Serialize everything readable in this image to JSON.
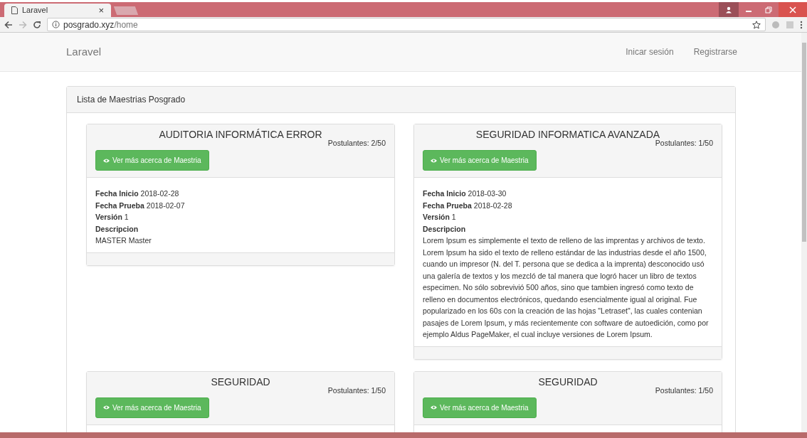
{
  "browser": {
    "tab": {
      "title": "Laravel",
      "close": "×",
      "selected": true
    },
    "address": {
      "host": "posgrado.xyz",
      "path": "/home"
    }
  },
  "navbar": {
    "brand": "Laravel",
    "links": [
      "Inicar sesión",
      "Registrarse"
    ]
  },
  "panel": {
    "title": "Lista de Maestrias Posgrado",
    "cards": [
      {
        "title": "AUDITORIA INFORMÁTICA ERROR",
        "applicants": "Postulantes: 2/50",
        "button": "Ver más acerca de Maestria",
        "fields": [
          {
            "label": "Fecha Inicio",
            "value": "2018-02-28"
          },
          {
            "label": "Fecha Prueba",
            "value": "2018-02-07"
          },
          {
            "label": "Versión",
            "value": "1"
          }
        ],
        "description_label": "Descripcion",
        "description": "MASTER Master"
      },
      {
        "title": "SEGURIDAD INFORMATICA AVANZADA",
        "applicants": "Postulantes: 1/50",
        "button": "Ver más acerca de Maestria",
        "fields": [
          {
            "label": "Fecha Inicio",
            "value": "2018-03-30"
          },
          {
            "label": "Fecha Prueba",
            "value": "2018-02-28"
          },
          {
            "label": "Versión",
            "value": "1"
          }
        ],
        "description_label": "Descripcion",
        "description": "Lorem Ipsum es simplemente el texto de relleno de las imprentas y archivos de texto. Lorem Ipsum ha sido el texto de relleno estándar de las industrias desde el año 1500, cuando un impresor (N. del T. persona que se dedica a la imprenta) desconocido usó una galería de textos y los mezcló de tal manera que logró hacer un libro de textos especimen. No sólo sobrevivió 500 años, sino que tambien ingresó como texto de relleno en documentos electrónicos, quedando esencialmente igual al original. Fue popularizado en los 60s con la creación de las hojas \"Letraset\", las cuales contenian pasajes de Lorem Ipsum, y más recientemente con software de autoedición, como por ejemplo Aldus PageMaker, el cual incluye versiones de Lorem Ipsum."
      },
      {
        "title": "SEGURIDAD",
        "applicants": "Postulantes: 1/50",
        "button": "Ver más acerca de Maestria"
      },
      {
        "title": "SEGURIDAD",
        "applicants": "Postulantes: 1/50",
        "button": "Ver más acerca de Maestria"
      }
    ]
  }
}
